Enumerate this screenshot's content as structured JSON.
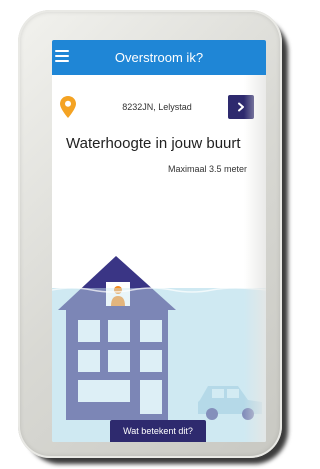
{
  "app": {
    "title": "Overstroom ik?"
  },
  "location": {
    "address": "8232JN, Lelystad",
    "go_button_label": ""
  },
  "main": {
    "headline": "Waterhoogte in jouw buurt",
    "maximum_label": "Maximaal 3.5 meter"
  },
  "footer": {
    "info_button_label": "Wat betekent dit?"
  },
  "colors": {
    "header": "#1f86d6",
    "accent": "#2e2a6e",
    "pin": "#f4a323",
    "water": "#cfe9f2",
    "house": "#3a3585",
    "person": "#f48a1e"
  },
  "icons": {
    "menu": "hamburger-menu-icon",
    "location": "map-pin-icon",
    "go": "chevron-right-icon"
  }
}
